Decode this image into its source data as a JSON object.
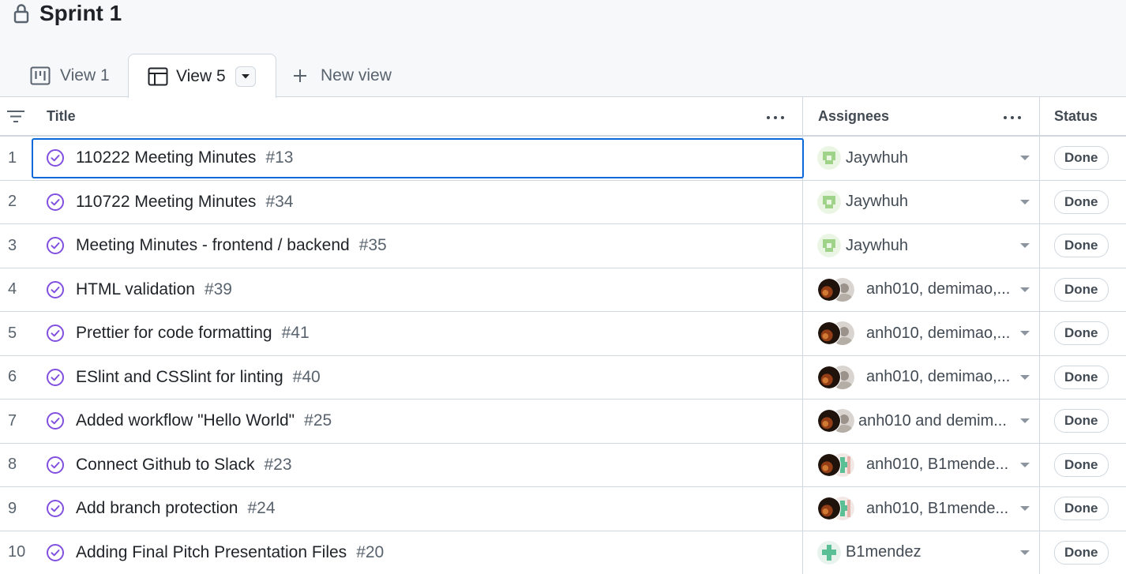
{
  "project": {
    "title": "Sprint 1"
  },
  "tabs": [
    {
      "label": "View 1",
      "icon": "board-icon",
      "active": false
    },
    {
      "label": "View 5",
      "icon": "table-icon",
      "active": true
    },
    {
      "label": "New view",
      "icon": "plus-icon",
      "active": false
    }
  ],
  "columns": {
    "title": "Title",
    "assignees": "Assignees",
    "status": "Status"
  },
  "colors": {
    "accent": "#0969da",
    "done_purple": "#8250df",
    "border": "#d0d7de"
  },
  "rows": [
    {
      "num": "1",
      "title": "110222 Meeting Minutes",
      "issue": "#13",
      "assignees": "Jaywhuh",
      "avatars": "single-green",
      "status": "Done",
      "selected": true
    },
    {
      "num": "2",
      "title": "110722 Meeting Minutes",
      "issue": "#34",
      "assignees": "Jaywhuh",
      "avatars": "single-green",
      "status": "Done"
    },
    {
      "num": "3",
      "title": "Meeting Minutes - frontend / backend",
      "issue": "#35",
      "assignees": "Jaywhuh",
      "avatars": "single-green",
      "status": "Done"
    },
    {
      "num": "4",
      "title": "HTML validation",
      "issue": "#39",
      "assignees": "anh010, demimao,...",
      "avatars": "stack-photo",
      "status": "Done"
    },
    {
      "num": "5",
      "title": "Prettier for code formatting",
      "issue": "#41",
      "assignees": "anh010, demimao,...",
      "avatars": "stack-photo",
      "status": "Done"
    },
    {
      "num": "6",
      "title": "ESlint and CSSlint for linting",
      "issue": "#40",
      "assignees": "anh010, demimao,...",
      "avatars": "stack-photo",
      "status": "Done"
    },
    {
      "num": "7",
      "title": "Added workflow \"Hello World\"",
      "issue": "#25",
      "assignees": "anh010 and demim...",
      "avatars": "stack-photo",
      "status": "Done"
    },
    {
      "num": "8",
      "title": "Connect Github to Slack",
      "issue": "#23",
      "assignees": "anh010, B1mende...",
      "avatars": "stack-teal",
      "status": "Done"
    },
    {
      "num": "9",
      "title": "Add branch protection",
      "issue": "#24",
      "assignees": "anh010, B1mende...",
      "avatars": "stack-teal",
      "status": "Done"
    },
    {
      "num": "10",
      "title": "Adding Final Pitch Presentation Files",
      "issue": "#20",
      "assignees": "B1mendez",
      "avatars": "single-teal",
      "status": "Done"
    }
  ]
}
